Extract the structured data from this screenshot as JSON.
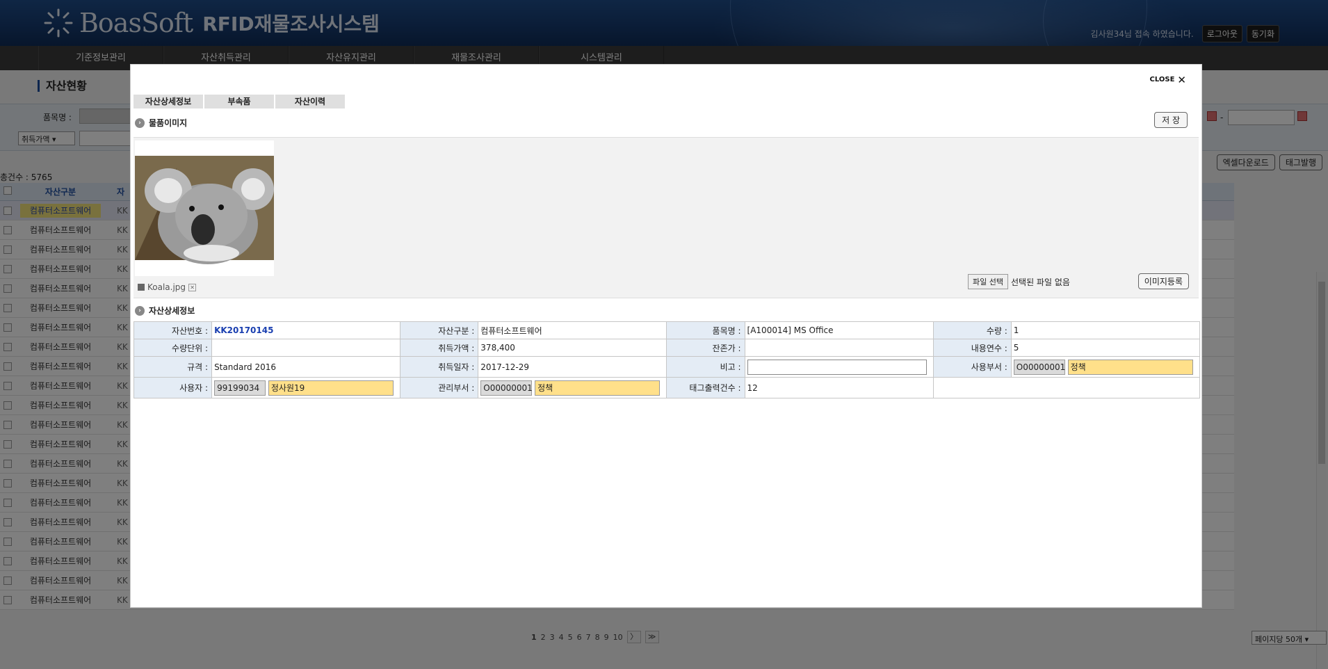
{
  "header": {
    "brand": "BoasSoft",
    "system_name": "RFID재물조사시스템",
    "welcome": "김사원34님 접속 하였습니다.",
    "logout_label": "로그아웃",
    "sync_label": "동기화"
  },
  "nav": {
    "items": [
      "기준정보관리",
      "자산취득관리",
      "자산유지관리",
      "재물조사관리",
      "시스템관리"
    ]
  },
  "background": {
    "page_title": "자산현황",
    "filter_label_item": "품목명 :",
    "filter_select_value": "취득가액",
    "date_separator": "-",
    "total_count": "총건수 : 5765",
    "excel_download": "엑셀다운로드",
    "tag_issue": "태그발행",
    "grid_header_asset_type": "자산구분",
    "grid_header_col2": "자",
    "grid_row_type": "컴퓨터소프트웨어",
    "grid_row_code_prefix": "KK",
    "grid_rows": 21,
    "pager": [
      "1",
      "2",
      "3",
      "4",
      "5",
      "6",
      "7",
      "8",
      "9",
      "10"
    ],
    "pager_next": "〉",
    "pager_last": "≫",
    "per_page": "페이지당 50개"
  },
  "modal": {
    "close_label": "CLOSE",
    "tabs": [
      "자산상세정보",
      "부속품",
      "자산이력"
    ],
    "image_section_title": "물품이미지",
    "save_label": "저 장",
    "file_name": "Koala.jpg",
    "file_select_label": "파일 선택",
    "no_file_label": "선택된 파일 없음",
    "image_register_label": "이미지등록",
    "detail_section_title": "자산상세정보",
    "details": {
      "asset_no_label": "자산번호 :",
      "asset_no": "KK20170145",
      "asset_type_label": "자산구분 :",
      "asset_type": "컴퓨터소프트웨어",
      "item_name_label": "품목명 :",
      "item_name": "[A100014] MS Office",
      "quantity_label": "수량 :",
      "quantity": "1",
      "unit_label": "수량단위 :",
      "unit": "",
      "acq_price_label": "취득가액 :",
      "acq_price": "378,400",
      "residual_label": "잔존가 :",
      "residual": "",
      "useful_life_label": "내용연수 :",
      "useful_life": "5",
      "spec_label": "규격 :",
      "spec": "Standard 2016",
      "acq_date_label": "취득일자 :",
      "acq_date": "2017-12-29",
      "note_label": "비고 :",
      "note": "",
      "use_dept_label": "사용부서 :",
      "use_dept_code": "O00000001",
      "use_dept_name": "정책",
      "user_label": "사용자 :",
      "user_code": "99199034",
      "user_name": "정사원19",
      "mgmt_dept_label": "관리부서 :",
      "mgmt_dept_code": "O00000001",
      "mgmt_dept_name": "정책",
      "tag_count_label": "태그출력건수 :",
      "tag_count": "12"
    }
  }
}
